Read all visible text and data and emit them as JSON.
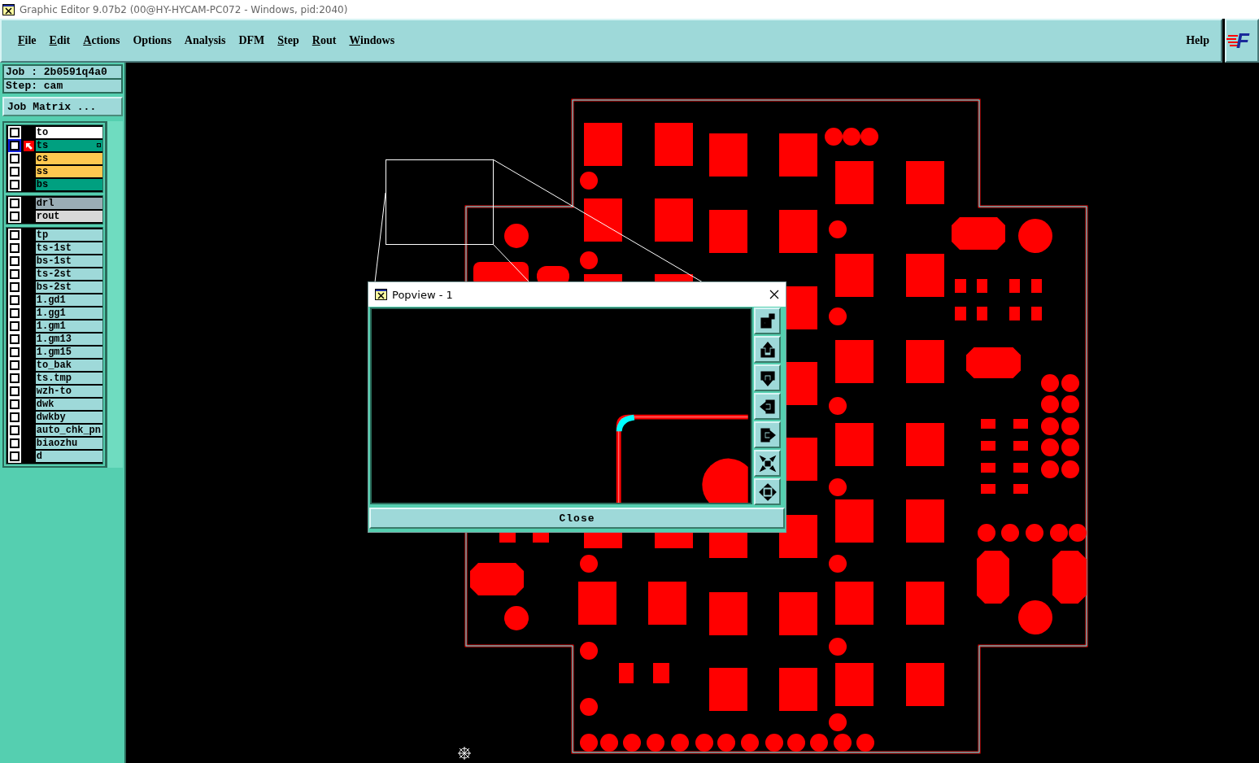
{
  "window": {
    "title": "Graphic Editor 9.07b2 (00@HY-HYCAM-PC072 - Windows, pid:2040)"
  },
  "menu": [
    {
      "label": "File",
      "mnemonic": true
    },
    {
      "label": "Edit",
      "mnemonic": true
    },
    {
      "label": "Actions",
      "mnemonic": true
    },
    {
      "label": "Options",
      "mnemonic": false
    },
    {
      "label": "Analysis",
      "mnemonic": false
    },
    {
      "label": "DFM",
      "mnemonic": false
    },
    {
      "label": "Step",
      "mnemonic": true
    },
    {
      "label": "Rout",
      "mnemonic": true
    },
    {
      "label": "Windows",
      "mnemonic": true
    }
  ],
  "help": {
    "label": "Help",
    "mnemonic": false
  },
  "logo": {
    "text": "F"
  },
  "job": "Job : 2b0591q4a0",
  "step": "Step: cam",
  "job_matrix_button": "Job Matrix ...",
  "layer_groups": [
    {
      "layers": [
        {
          "name": "to",
          "color": "#ffffff",
          "checked": false,
          "selected": false
        },
        {
          "name": "ts",
          "color": "#00a080",
          "checked": false,
          "selected": true
        },
        {
          "name": "cs",
          "color": "#ffc850",
          "checked": false,
          "selected": false
        },
        {
          "name": "ss",
          "color": "#ffc850",
          "checked": false,
          "selected": false
        },
        {
          "name": "bs",
          "color": "#00a080",
          "checked": false,
          "selected": false
        }
      ]
    },
    {
      "layers": [
        {
          "name": "drl",
          "color": "#9aadb5",
          "checked": false,
          "selected": false
        },
        {
          "name": "rout",
          "color": "#d8d8d8",
          "checked": false,
          "selected": false
        }
      ]
    },
    {
      "layers": [
        {
          "name": "tp",
          "color": "#9ed9d9",
          "checked": false,
          "selected": false
        },
        {
          "name": "ts-1st",
          "color": "#9ed9d9",
          "checked": false,
          "selected": false
        },
        {
          "name": "bs-1st",
          "color": "#9ed9d9",
          "checked": false,
          "selected": false
        },
        {
          "name": "ts-2st",
          "color": "#9ed9d9",
          "checked": false,
          "selected": false
        },
        {
          "name": "bs-2st",
          "color": "#9ed9d9",
          "checked": false,
          "selected": false
        },
        {
          "name": "1.gd1",
          "color": "#9ed9d9",
          "checked": false,
          "selected": false
        },
        {
          "name": "1.gg1",
          "color": "#9ed9d9",
          "checked": false,
          "selected": false
        },
        {
          "name": "1.gm1",
          "color": "#9ed9d9",
          "checked": false,
          "selected": false
        },
        {
          "name": "1.gm13",
          "color": "#9ed9d9",
          "checked": false,
          "selected": false
        },
        {
          "name": "1.gm15",
          "color": "#9ed9d9",
          "checked": false,
          "selected": false
        },
        {
          "name": "to_bak",
          "color": "#9ed9d9",
          "checked": false,
          "selected": false
        },
        {
          "name": "ts.tmp",
          "color": "#9ed9d9",
          "checked": false,
          "selected": false
        },
        {
          "name": "wzh-to",
          "color": "#9ed9d9",
          "checked": false,
          "selected": false
        },
        {
          "name": "dwk",
          "color": "#9ed9d9",
          "checked": false,
          "selected": false
        },
        {
          "name": "dwkby",
          "color": "#9ed9d9",
          "checked": false,
          "selected": false
        },
        {
          "name": "auto_chk_pn",
          "color": "#9ed9d9",
          "checked": false,
          "selected": false
        },
        {
          "name": "biaozhu",
          "color": "#9ed9d9",
          "checked": false,
          "selected": false
        },
        {
          "name": "d",
          "color": "#9ed9d9",
          "checked": false,
          "selected": false
        }
      ]
    }
  ],
  "popview": {
    "title": "Popview - 1",
    "close_button": "Close"
  }
}
